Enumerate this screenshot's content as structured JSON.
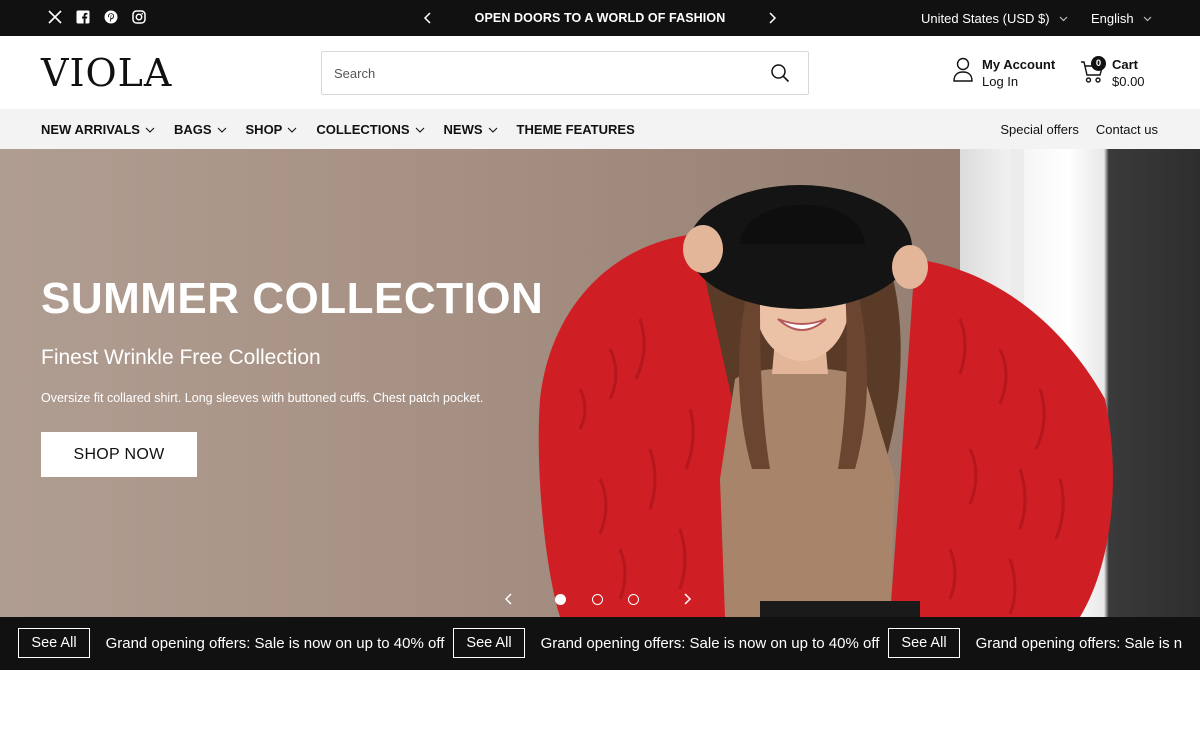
{
  "topbar": {
    "social_icons": [
      "x-icon",
      "facebook-icon",
      "pinterest-icon",
      "instagram-icon"
    ],
    "announcement": "OPEN DOORS TO A WORLD OF FASHION",
    "currency": "United States (USD $)",
    "language": "English"
  },
  "header": {
    "logo": "VIOLA",
    "search_placeholder": "Search",
    "account_title": "My Account",
    "account_sub": "Log In",
    "cart_count": "0",
    "cart_title": "Cart",
    "cart_total": "$0.00"
  },
  "nav": {
    "items": [
      {
        "label": "NEW ARRIVALS"
      },
      {
        "label": "BAGS"
      },
      {
        "label": "SHOP"
      },
      {
        "label": "COLLECTIONS"
      },
      {
        "label": "NEWS"
      },
      {
        "label": "THEME FEATURES"
      }
    ],
    "right": [
      "Special offers",
      "Contact us"
    ]
  },
  "hero": {
    "title": "SUMMER COLLECTION",
    "subtitle": "Finest Wrinkle Free Collection",
    "description": "Oversize fit collared shirt. Long sleeves with buttoned cuffs. Chest patch pocket.",
    "button": "SHOP NOW",
    "slides": 3,
    "active_slide": 1
  },
  "marquee": {
    "tail": "off",
    "text": "Grand opening offers: Sale is now on up to 40% off",
    "last_text": "Grand opening offers: Sale is n",
    "button": "See All"
  },
  "colors": {
    "dark": "#111111",
    "nav_bg": "#f3f3f3",
    "hero_bg": "#a58f82",
    "accent_red": "#d21f22"
  }
}
